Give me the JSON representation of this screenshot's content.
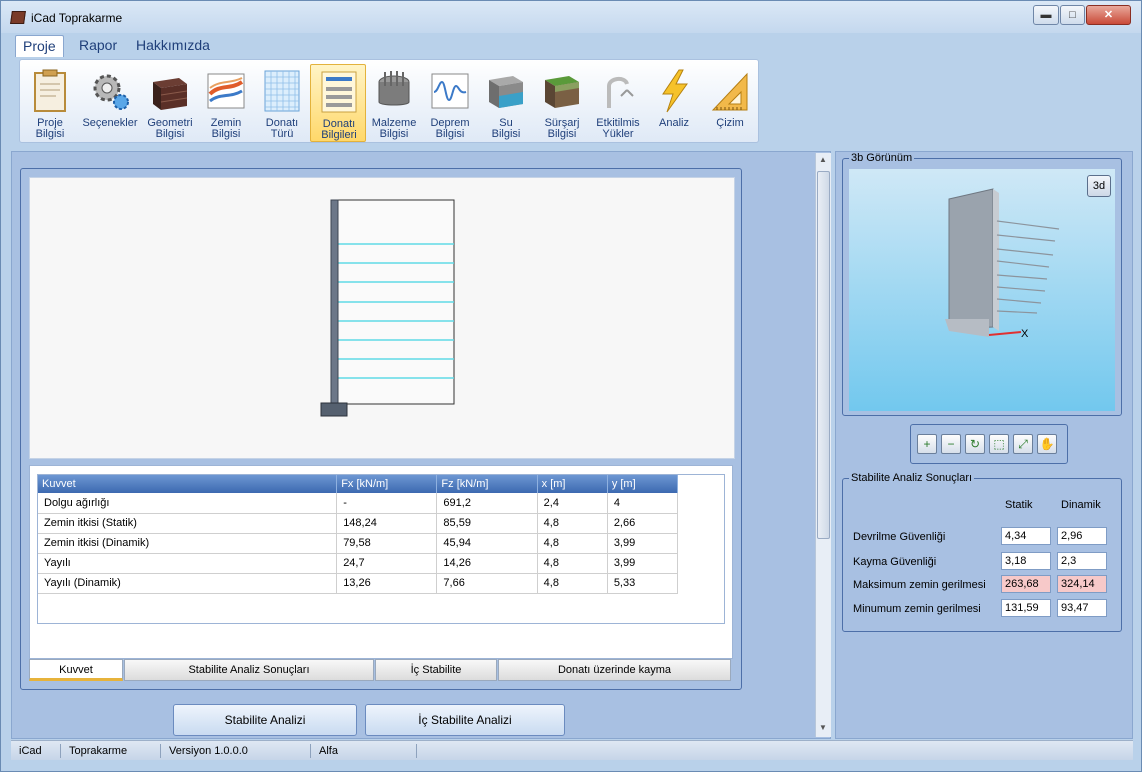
{
  "window": {
    "title": "iCad Toprakarme",
    "controls": {
      "minimize": "▬",
      "maximize": "□",
      "close": "✕"
    }
  },
  "menu": {
    "items": [
      {
        "label": "Proje",
        "active": true
      },
      {
        "label": "Rapor",
        "active": false
      },
      {
        "label": "Hakkımızda",
        "active": false
      }
    ]
  },
  "ribbon": {
    "buttons": [
      {
        "line1": "Proje",
        "line2": "Bilgisi",
        "icon": "clipboard-icon"
      },
      {
        "line1": "Seçenekler",
        "line2": "",
        "icon": "gears-icon"
      },
      {
        "line1": "Geometri",
        "line2": "Bilgisi",
        "icon": "wall-block-icon"
      },
      {
        "line1": "Zemin",
        "line2": "Bilgisi",
        "icon": "soil-layers-icon"
      },
      {
        "line1": "Donatı",
        "line2": "Türü",
        "icon": "grid-mesh-icon"
      },
      {
        "line1": "Donatı",
        "line2": "Bilgileri",
        "icon": "reinforcement-layers-icon",
        "active": true
      },
      {
        "line1": "Malzeme",
        "line2": "Bilgisi",
        "icon": "material-drum-icon"
      },
      {
        "line1": "Deprem",
        "line2": "Bilgisi",
        "icon": "seismograph-icon"
      },
      {
        "line1": "Su",
        "line2": "Bilgisi",
        "icon": "water-block-icon"
      },
      {
        "line1": "Sürşarj",
        "line2": "Bilgisi",
        "icon": "surcharge-block-icon"
      },
      {
        "line1": "Etkitilmis",
        "line2": "Yükler",
        "icon": "hook-load-icon"
      },
      {
        "line1": "Analiz",
        "line2": "",
        "icon": "lightning-icon"
      },
      {
        "line1": "Çizim",
        "line2": "",
        "icon": "set-square-icon"
      }
    ]
  },
  "force_table": {
    "columns": [
      "Kuvvet",
      "Fx [kN/m]",
      "Fz [kN/m]",
      "x [m]",
      "y [m]"
    ],
    "rows": [
      [
        "Dolgu ağırlığı",
        "-",
        "691,2",
        "2,4",
        "4"
      ],
      [
        "Zemin itkisi (Statik)",
        "148,24",
        "85,59",
        "4,8",
        "2,66"
      ],
      [
        "Zemin itkisi (Dinamik)",
        "79,58",
        "45,94",
        "4,8",
        "3,99"
      ],
      [
        "Yayılı",
        "24,7",
        "14,26",
        "4,8",
        "3,99"
      ],
      [
        "Yayılı (Dinamik)",
        "13,26",
        "7,66",
        "4,8",
        "5,33"
      ]
    ]
  },
  "tabs": [
    {
      "label": "Kuvvet",
      "active": true
    },
    {
      "label": "Stabilite Analiz Sonuçları",
      "active": false
    },
    {
      "label": "İç Stabilite",
      "active": false
    },
    {
      "label": "Donatı üzerinde kayma",
      "active": false
    }
  ],
  "actions": {
    "stability_analysis": "Stabilite Analizi",
    "internal_stability_analysis": "İç Stabilite Analizi"
  },
  "view3d": {
    "legend": "3b Görünüm",
    "mode_button": "3d",
    "axis_label": "X"
  },
  "view_tools": [
    {
      "icon": "zoom-in-icon",
      "glyph": "+"
    },
    {
      "icon": "zoom-out-icon",
      "glyph": "−"
    },
    {
      "icon": "rotate-icon",
      "glyph": "↻"
    },
    {
      "icon": "zoom-window-icon",
      "glyph": "⬚"
    },
    {
      "icon": "zoom-extents-icon",
      "glyph": "⤢"
    },
    {
      "icon": "pan-hand-icon",
      "glyph": "✋"
    }
  ],
  "stability": {
    "legend": "Stabilite Analiz Sonuçları",
    "headers": {
      "static": "Statik",
      "dynamic": "Dinamik"
    },
    "rows": [
      {
        "label": "Devrilme Güvenliği",
        "static": "4,34",
        "dynamic": "2,96",
        "highlight": false
      },
      {
        "label": "Kayma Güvenliği",
        "static": "3,18",
        "dynamic": "2,3",
        "highlight": false
      },
      {
        "label": "Maksimum zemin gerilmesi",
        "static": "263,68",
        "dynamic": "324,14",
        "highlight": true
      },
      {
        "label": "Minumum zemin gerilmesi",
        "static": "131,59",
        "dynamic": "93,47",
        "highlight": false
      }
    ]
  },
  "statusbar": {
    "app": "iCad",
    "module": "Toprakarme",
    "version": "Versiyon 1.0.0.0",
    "stage": "Alfa"
  },
  "colors": {
    "reinforcement_lines": "#5fd9e6",
    "highlight_cell": "#f7c9c9",
    "table_header": "#3c69b0"
  }
}
